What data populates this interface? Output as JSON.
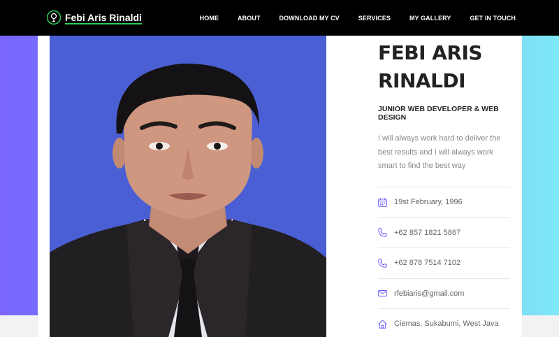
{
  "nav": {
    "brand": "Febi Aris Rinaldi",
    "links": [
      "HOME",
      "ABOUT",
      "DOWNLOAD MY CV",
      "SERVICES",
      "MY GALLERY",
      "GET IN TOUCH"
    ]
  },
  "profile": {
    "name_line1": "FEBI ARIS",
    "name_line2": "RINALDI",
    "role": "JUNIOR WEB DEVELOPER & WEB DESIGN",
    "bio": "I will always work hard to deliver the best results and I will always work smart to find the best way"
  },
  "contacts": [
    {
      "icon": "calendar-icon",
      "text": "19st February, 1996"
    },
    {
      "icon": "phone-icon",
      "text": "+62 857 1821 5867"
    },
    {
      "icon": "phone-icon",
      "text": "+62 878 7514 7102"
    },
    {
      "icon": "mail-icon",
      "text": "rfebiaris@gmail.com"
    },
    {
      "icon": "home-icon",
      "text": "Ciemas, Sukabumi, West Java"
    }
  ],
  "colors": {
    "accent": "#6a5cff",
    "brand_underline": "#2ecc55",
    "photo_bg": "#4a5fd3"
  }
}
